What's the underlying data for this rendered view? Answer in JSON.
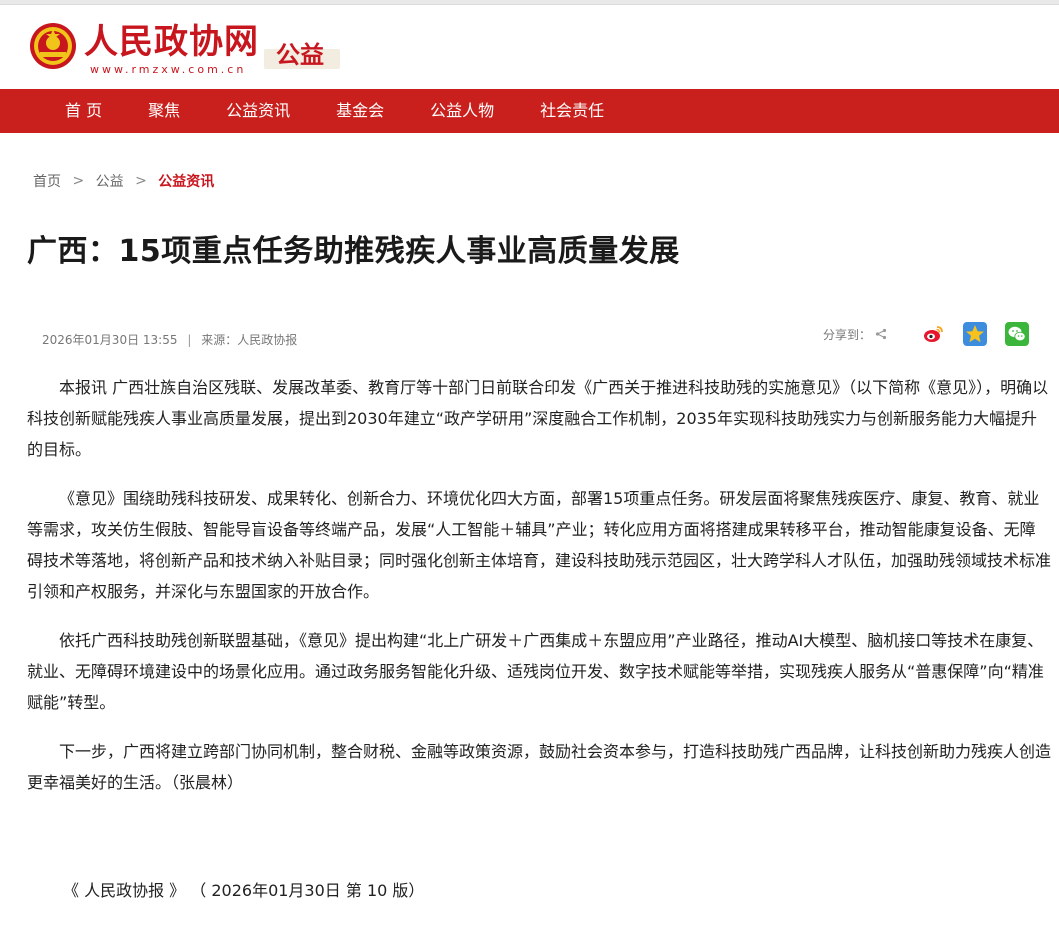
{
  "header": {
    "logo_text": "人民政协网",
    "logo_url": "www.rmzxw.com.cn",
    "channel": "公益"
  },
  "nav": {
    "items": [
      "首 页",
      "聚焦",
      "公益资讯",
      "基金会",
      "公益人物",
      "社会责任"
    ]
  },
  "breadcrumb": {
    "items": [
      "首页",
      "公益",
      "公益资讯"
    ],
    "separator": ">"
  },
  "article": {
    "title": "广西：15项重点任务助推残疾人事业高质量发展",
    "date": "2026年01月30日 13:55",
    "source": "来源：人民政协报",
    "meta_separator": "|",
    "share_label": "分享到：",
    "share_icons": [
      "weibo-icon",
      "qzone-icon",
      "wechat-icon"
    ],
    "paragraphs": [
      "本报讯 广西壮族自治区残联、发展改革委、教育厅等十部门日前联合印发《广西关于推进科技助残的实施意见》（以下简称《意见》），明确以科技创新赋能残疾人事业高质量发展，提出到2030年建立“政产学研用”深度融合工作机制，2035年实现科技助残实力与创新服务能力大幅提升的目标。",
      "《意见》围绕助残科技研发、成果转化、创新合力、环境优化四大方面，部署15项重点任务。研发层面将聚焦残疾医疗、康复、教育、就业等需求，攻关仿生假肢、智能导盲设备等终端产品，发展“人工智能＋辅具”产业；转化应用方面将搭建成果转移平台，推动智能康复设备、无障碍技术等落地，将创新产品和技术纳入补贴目录；同时强化创新主体培育，建设科技助残示范园区，壮大跨学科人才队伍，加强助残领域技术标准引领和产权服务，并深化与东盟国家的开放合作。",
      "依托广西科技助残创新联盟基础，《意见》提出构建“北上广研发＋广西集成＋东盟应用”产业路径，推动AI大模型、脑机接口等技术在康复、就业、无障碍环境建设中的场景化应用。通过政务服务智能化升级、适残岗位开发、数字技术赋能等举措，实现残疾人服务从“普惠保障”向“精准赋能”转型。",
      "下一步，广西将建立跨部门协同机制，整合财税、金融等政策资源，鼓励社会资本参与，打造科技助残广西品牌，让科技创新助力残疾人创造更幸福美好的生活。（张晨林）"
    ],
    "publication": "《 人民政协报 》 （ 2026年01月30日 第 10 版）"
  },
  "colors": {
    "brand_red": "#c9201d",
    "breadcrumb_active": "#c8161e"
  }
}
